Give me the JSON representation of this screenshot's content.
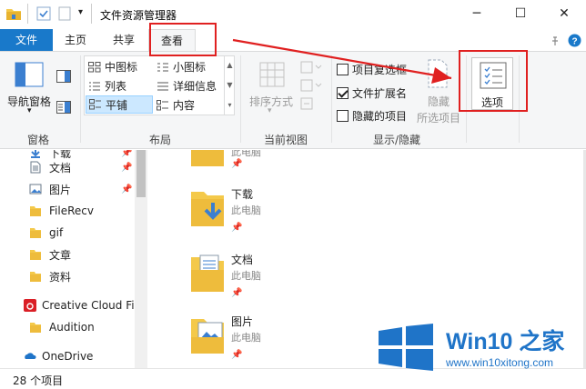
{
  "window": {
    "title": "文件资源管理器",
    "minimize": "─",
    "maximize": "☐",
    "close": "✕"
  },
  "tabs": [
    {
      "label": "文件"
    },
    {
      "label": "主页"
    },
    {
      "label": "共享"
    },
    {
      "label": "查看"
    }
  ],
  "ribbon": {
    "panes": {
      "nav_pane_label": "导航窗格",
      "group": "窗格"
    },
    "layout": {
      "group": "布局",
      "items": [
        "中图标",
        "小图标",
        "列表",
        "详细信息",
        "平铺",
        "内容"
      ],
      "selected": "平铺"
    },
    "current_view": {
      "sort_label": "排序方式",
      "group": "当前视图"
    },
    "show_hide": {
      "group": "显示/隐藏",
      "checkboxes": [
        {
          "label": "项目复选框",
          "checked": false
        },
        {
          "label": "文件扩展名",
          "checked": true
        },
        {
          "label": "隐藏的项目",
          "checked": false
        }
      ],
      "hide_selected_label_1": "隐藏",
      "hide_selected_label_2": "所选项目"
    },
    "options_label": "选项"
  },
  "nav": {
    "items": [
      {
        "label": "下载",
        "icon": "download-icon",
        "pinned": true
      },
      {
        "label": "文档",
        "icon": "document-icon",
        "pinned": true
      },
      {
        "label": "图片",
        "icon": "picture-icon",
        "pinned": true
      },
      {
        "label": "FileRecv",
        "icon": "folder-icon",
        "pinned": false
      },
      {
        "label": "gif",
        "icon": "folder-icon",
        "pinned": false
      },
      {
        "label": "文章",
        "icon": "folder-icon",
        "pinned": false
      },
      {
        "label": "资料",
        "icon": "folder-icon",
        "pinned": false
      },
      {
        "label": "Creative Cloud Fil",
        "icon": "creative-cloud-icon",
        "pinned": false
      },
      {
        "label": "Audition",
        "icon": "folder-icon",
        "pinned": false
      },
      {
        "label": "OneDrive",
        "icon": "onedrive-icon",
        "pinned": false
      }
    ]
  },
  "content": {
    "items": [
      {
        "name": "下载",
        "location": "此电脑",
        "icon": "download-folder-icon"
      },
      {
        "name": "文档",
        "location": "此电脑",
        "icon": "documents-folder-icon"
      },
      {
        "name": "图片",
        "location": "此电脑",
        "icon": "pictures-folder-icon"
      }
    ],
    "partial_top_label": "此电脑"
  },
  "status": {
    "item_count": "28 个项目"
  },
  "watermark": {
    "brand": "Win10 之家",
    "url": "www.win10xitong.com"
  },
  "colors": {
    "accent": "#1979ca",
    "annotation": "#e02020",
    "folder": "#f4c94a",
    "watermark": "#1f74c8"
  }
}
